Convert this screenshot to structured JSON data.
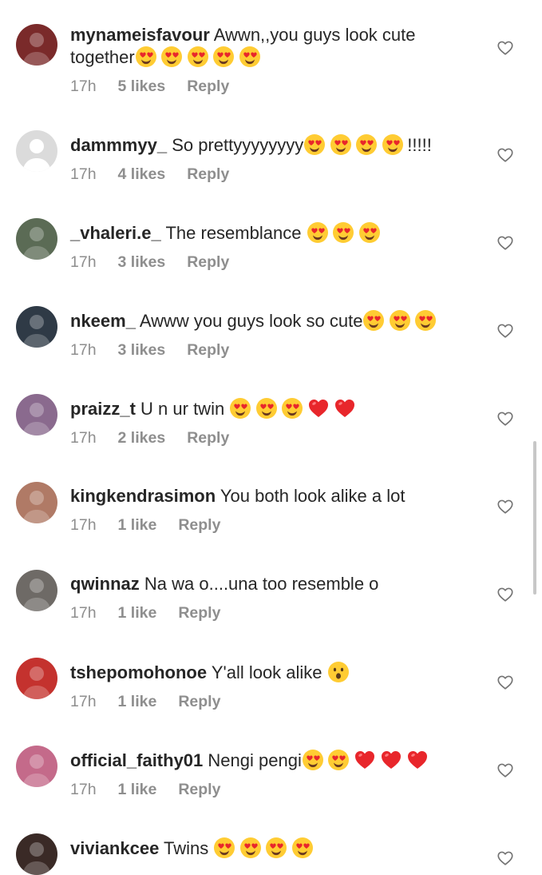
{
  "comments": [
    {
      "username": "mynameisfavour",
      "text": "Awwn,,you guys look cute together",
      "emojis": [
        "heart-eyes",
        "heart-eyes",
        "heart-eyes",
        "heart-eyes",
        "heart-eyes"
      ],
      "suffix": "",
      "time": "17h",
      "likes": "5 likes",
      "reply": "Reply",
      "avatar_color": "#7a2a2a"
    },
    {
      "username": "dammmyy_",
      "text": "So prettyyyyyyyy",
      "emojis": [
        "heart-eyes",
        "heart-eyes",
        "heart-eyes",
        "heart-eyes"
      ],
      "suffix": "!!!!!",
      "time": "17h",
      "likes": "4 likes",
      "reply": "Reply",
      "avatar_color": "#dbdbdb"
    },
    {
      "username": "_vhaleri.e_",
      "text": "The resemblance ",
      "emojis": [
        "heart-eyes",
        "heart-eyes",
        "heart-eyes"
      ],
      "suffix": "",
      "time": "17h",
      "likes": "3 likes",
      "reply": "Reply",
      "avatar_color": "#5b6b55"
    },
    {
      "username": "nkeem_",
      "text": "Awww you guys look so cute",
      "emojis": [
        "heart-eyes",
        "heart-eyes",
        "heart-eyes"
      ],
      "suffix": "",
      "time": "17h",
      "likes": "3 likes",
      "reply": "Reply",
      "avatar_color": "#2f3a46"
    },
    {
      "username": "praizz_t",
      "text": "U n ur twin ",
      "emojis": [
        "heart-eyes",
        "heart-eyes",
        "heart-eyes",
        "red-heart",
        "red-heart"
      ],
      "suffix": "",
      "time": "17h",
      "likes": "2 likes",
      "reply": "Reply",
      "avatar_color": "#8a6a8e"
    },
    {
      "username": "kingkendrasimon",
      "text": "You both look alike a lot",
      "emojis": [],
      "suffix": "",
      "time": "17h",
      "likes": "1 like",
      "reply": "Reply",
      "avatar_color": "#b07a66"
    },
    {
      "username": "qwinnaz",
      "text": "Na wa o....una too resemble o",
      "emojis": [],
      "suffix": "",
      "time": "17h",
      "likes": "1 like",
      "reply": "Reply",
      "avatar_color": "#6e6a66"
    },
    {
      "username": "tshepomohonoe",
      "text": "Y'all look alike ",
      "emojis": [
        "surprised"
      ],
      "suffix": "",
      "time": "17h",
      "likes": "1 like",
      "reply": "Reply",
      "avatar_color": "#c4322e"
    },
    {
      "username": "official_faithy01",
      "text": "Nengi pengi",
      "emojis": [
        "heart-eyes",
        "heart-eyes",
        "red-heart",
        "red-heart",
        "red-heart"
      ],
      "suffix": "",
      "time": "17h",
      "likes": "1 like",
      "reply": "Reply",
      "avatar_color": "#c46a8a"
    },
    {
      "username": "viviankcee",
      "text": "Twins ",
      "emojis": [
        "heart-eyes",
        "heart-eyes",
        "heart-eyes",
        "heart-eyes"
      ],
      "suffix": "",
      "time": "",
      "likes": "",
      "reply": "",
      "avatar_color": "#3a2a26"
    }
  ],
  "icons": {
    "like": "heart-outline-icon"
  },
  "colors": {
    "text": "#262626",
    "meta": "#8e8e8e",
    "emoji_face": "#ffcc33",
    "emoji_heart": "#e8262b"
  }
}
